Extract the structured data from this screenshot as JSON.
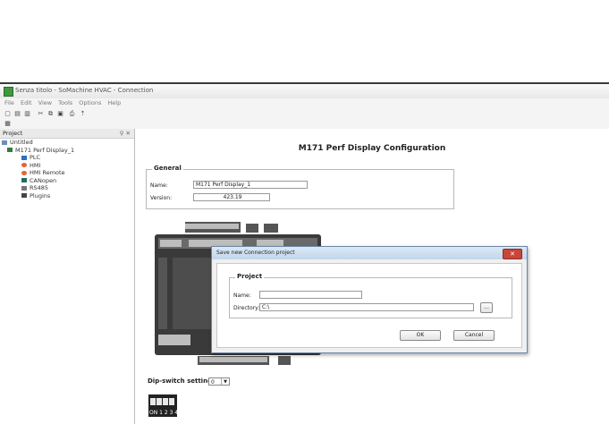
{
  "window": {
    "title": "Senza titolo - SoMachine HVAC - Connection"
  },
  "menu": [
    "File",
    "Edit",
    "View",
    "Tools",
    "Options",
    "Help"
  ],
  "toolbar": {
    "icons": [
      "new-icon",
      "open-icon",
      "save-icon",
      "cut-icon",
      "copy-icon",
      "paste-icon",
      "print-icon",
      "pin-icon"
    ],
    "glyphs": [
      "▢",
      "▤",
      "▥",
      "✂",
      "⧉",
      "▣",
      "⎙",
      "⇡"
    ],
    "second_row_glyph": "▦"
  },
  "project_panel": {
    "title": "Project",
    "pin": "⚲ ✕",
    "tree": [
      {
        "label": "Untitled",
        "indent": 0,
        "icon": "untitled-icon"
      },
      {
        "label": "M171 Perf Display_1",
        "indent": 1,
        "icon": "device-icon"
      },
      {
        "label": "PLC",
        "indent": 2,
        "icon": "plc-icon"
      },
      {
        "label": "HMI",
        "indent": 2,
        "icon": "hmi-icon"
      },
      {
        "label": "HMI Remote",
        "indent": 2,
        "icon": "hmi-remote-icon"
      },
      {
        "label": "CANopen",
        "indent": 2,
        "icon": "canopen-icon"
      },
      {
        "label": "RS485",
        "indent": 2,
        "icon": "rs485-icon"
      },
      {
        "label": "Plugins",
        "indent": 2,
        "icon": "plugins-icon"
      }
    ]
  },
  "config": {
    "heading": "M171 Perf Display Configuration",
    "general_legend": "General",
    "name_label": "Name:",
    "name_value": "M171 Perf Display_1",
    "version_label": "Version:",
    "version_value": "423.19",
    "dip_label": "Dip-switch setting:",
    "dip_value": "0",
    "dip_numbers": "ON 1  2  3  4"
  },
  "modal": {
    "title": "Save new Connection project",
    "close": "✕",
    "legend": "Project",
    "name_label": "Name:",
    "name_value": "",
    "directory_label": "Directory:",
    "directory_value": "C:\\",
    "browse": "...",
    "ok": "OK",
    "cancel": "Cancel"
  },
  "colors": {
    "accent_blue": "#c2d6eb",
    "close_red": "#c9453a",
    "device_dark": "#3a3a3a"
  }
}
